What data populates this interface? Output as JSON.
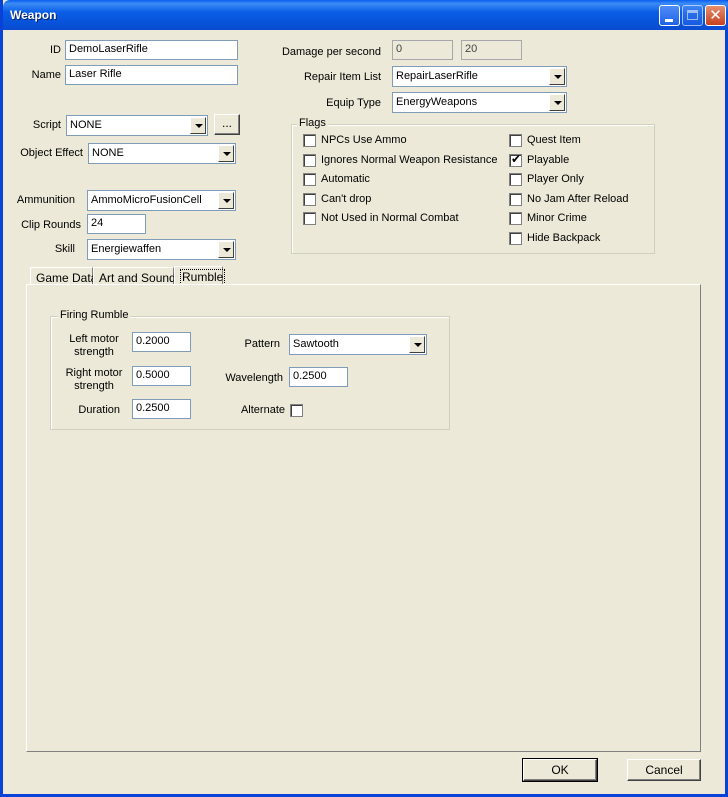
{
  "window": {
    "title": "Weapon"
  },
  "fields": {
    "id_label": "ID",
    "id_value": "DemoLaserRifle",
    "name_label": "Name",
    "name_value": "Laser Rifle",
    "script_label": "Script",
    "script_value": "NONE",
    "script_browse": "...",
    "object_effect_label": "Object Effect",
    "object_effect_value": "NONE",
    "ammunition_label": "Ammunition",
    "ammunition_value": "AmmoMicroFusionCell",
    "clip_rounds_label": "Clip Rounds",
    "clip_rounds_value": "24",
    "skill_label": "Skill",
    "skill_value": "Energiewaffen",
    "dps_label": "Damage per second",
    "dps_value1": "0",
    "dps_value2": "20",
    "repair_label": "Repair Item List",
    "repair_value": "RepairLaserRifle",
    "equip_label": "Equip Type",
    "equip_value": "EnergyWeapons"
  },
  "flags": {
    "title": "Flags",
    "items": [
      {
        "label": "NPCs Use Ammo",
        "checked": false
      },
      {
        "label": "Ignores Normal Weapon Resistance",
        "checked": false
      },
      {
        "label": "Automatic",
        "checked": false
      },
      {
        "label": "Can't drop",
        "checked": false
      },
      {
        "label": "Not Used in Normal Combat",
        "checked": false
      },
      {
        "label": "Quest Item",
        "checked": false
      },
      {
        "label": "Playable",
        "checked": true
      },
      {
        "label": "Player Only",
        "checked": false
      },
      {
        "label": "No Jam After Reload",
        "checked": false
      },
      {
        "label": "Minor Crime",
        "checked": false
      },
      {
        "label": "Hide Backpack",
        "checked": false
      }
    ]
  },
  "tabs": [
    {
      "label": "Game Data",
      "active": false
    },
    {
      "label": "Art and Sound",
      "active": false
    },
    {
      "label": "Rumble",
      "active": true
    }
  ],
  "rumble": {
    "group_title": "Firing Rumble",
    "left_motor_label_1": "Left motor",
    "left_motor_label_2": "strength",
    "left_motor_value": "0.2000",
    "right_motor_label_1": "Right motor",
    "right_motor_label_2": "strength",
    "right_motor_value": "0.5000",
    "duration_label": "Duration",
    "duration_value": "0.2500",
    "pattern_label": "Pattern",
    "pattern_value": "Sawtooth",
    "wavelength_label": "Wavelength",
    "wavelength_value": "0.2500",
    "alternate_label": "Alternate",
    "alternate_checked": false
  },
  "buttons": {
    "ok": "OK",
    "cancel": "Cancel"
  },
  "colors": {
    "titlebar": "#0a5ef0",
    "window_bg": "#ece9d8",
    "input_border": "#7f9db9"
  }
}
